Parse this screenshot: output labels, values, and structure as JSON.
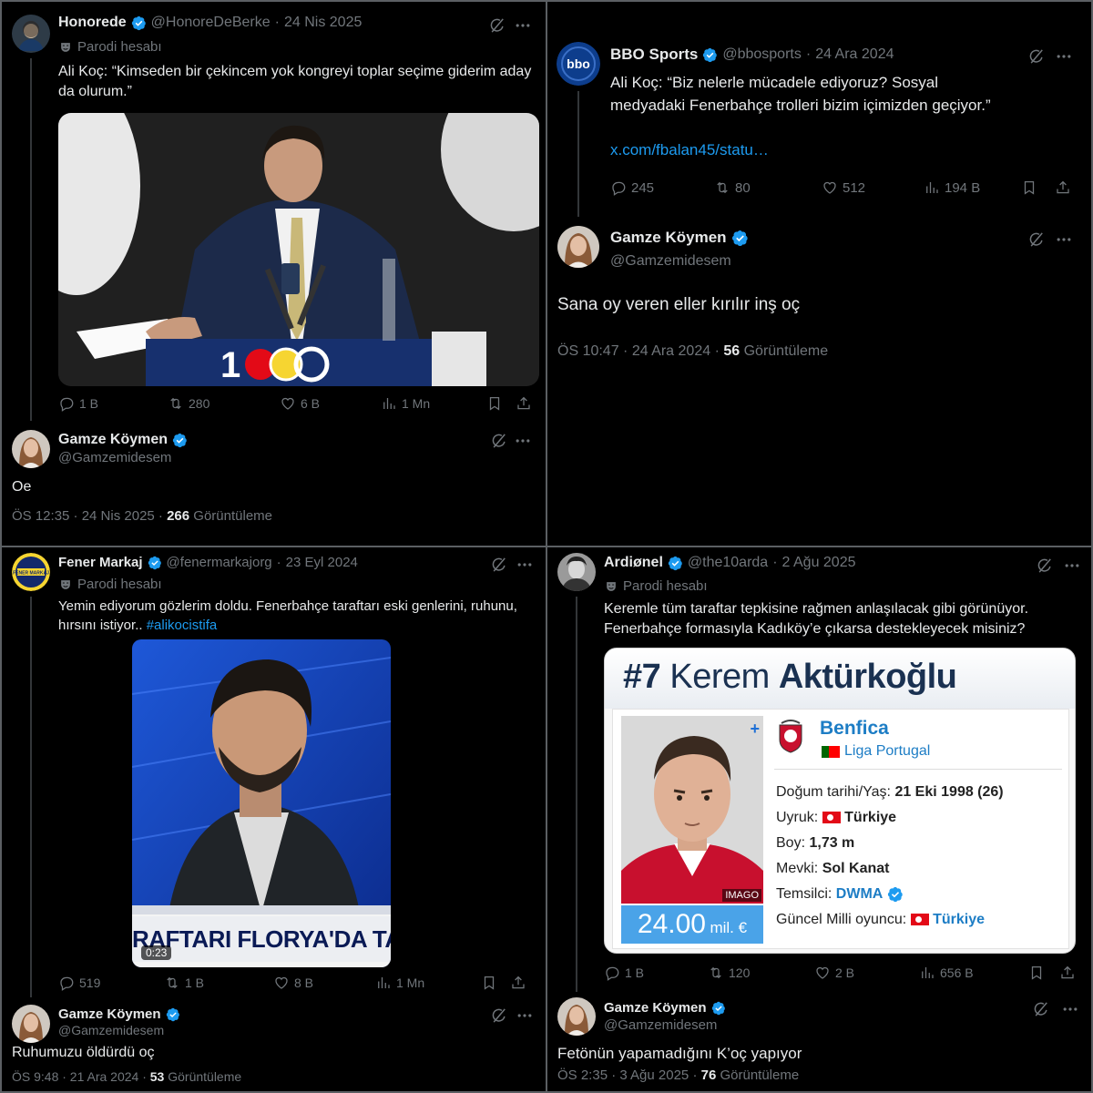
{
  "q1": {
    "author": {
      "name": "Honorede",
      "handle": "@HonoreDeBerke",
      "date": "24 Nis 2025",
      "label": "Parodi hesabı"
    },
    "text": "Ali Koç: “Kimseden bir çekincem yok kongreyi toplar seçime giderim aday da olurum.”",
    "stats": {
      "replies": "1 B",
      "reposts": "280",
      "likes": "6 B",
      "views": "1 Mn"
    },
    "reply": {
      "name": "Gamze Köymen",
      "handle": "@Gamzemidesem",
      "text": "Oe",
      "time": "ÖS 12:35 · 24 Nis 2025 · ",
      "views": "266",
      "views_label": "Görüntüleme"
    }
  },
  "q2": {
    "author": {
      "name": "BBO Sports",
      "handle": "@bbosports",
      "date": "24 Ara 2024",
      "avatar_text": "bbo"
    },
    "text": "Ali Koç: “Biz nelerle mücadele ediyoruz? Sosyal medyadaki Fenerbahçe trolleri bizim içimizden geçiyor.”",
    "link": "x.com/fbalan45/statu…",
    "stats": {
      "replies": "245",
      "reposts": "80",
      "likes": "512",
      "views": "194 B"
    },
    "reply": {
      "name": "Gamze Köymen",
      "handle": "@Gamzemidesem",
      "text": "Sana oy veren eller kırılır inş oç",
      "time": "ÖS 10:47 · 24 Ara 2024 · ",
      "views": "56",
      "views_label": "Görüntüleme"
    }
  },
  "q3": {
    "author": {
      "name": "Fener Markaj",
      "handle": "@fenermarkajorg",
      "date": "23 Eyl 2024",
      "label": "Parodi hesabı",
      "avatar_text": "FENER MARKAJ"
    },
    "text": "Yemin ediyorum gözlerim doldu. Fenerbahçe taraftarı eski genlerini, ruhunu, hırsını istiyor.. ",
    "hashtag": "#alikocistifa",
    "video": {
      "banner": "RAFTARI FLORYA'DA TAKI",
      "duration": "0:23"
    },
    "stats": {
      "replies": "519",
      "reposts": "1 B",
      "likes": "8 B",
      "views": "1 Mn"
    },
    "reply": {
      "name": "Gamze Köymen",
      "handle": "@Gamzemidesem",
      "text": "Ruhumuzu öldürdü oç",
      "time": "ÖS 9:48 · 21 Ara 2024 · ",
      "views": "53",
      "views_label": "Görüntüleme"
    }
  },
  "q4": {
    "author": {
      "name": "Ardiønel",
      "handle": "@the10arda",
      "date": "2 Ağu 2025",
      "label": "Parodi hesabı"
    },
    "text": "Keremle tüm taraftar tepkisine rağmen  anlaşılacak gibi görünüyor. Fenerbahçe formasıyla Kadıköy’e çıkarsa destekleyecek misiniz?",
    "card": {
      "number": "#7",
      "first_name": "Kerem",
      "last_name": "Aktürkoğlu",
      "club": "Benfica",
      "league": "Liga Portugal",
      "photo_credit": "IMAGO",
      "value": "24.00",
      "value_unit": "mil. €",
      "rows": [
        {
          "label": "Doğum tarihi/Yaş:",
          "value": "21 Eki 1998 (26)"
        },
        {
          "label": "Uyruk:",
          "value": "Türkiye"
        },
        {
          "label": "Boy:",
          "value": "1,73 m"
        },
        {
          "label": "Mevki:",
          "value": "Sol Kanat"
        },
        {
          "label": "Temsilci:",
          "value": "DWMA"
        },
        {
          "label": "Güncel Milli oyuncu:",
          "value": "Türkiye"
        }
      ]
    },
    "stats": {
      "replies": "1 B",
      "reposts": "120",
      "likes": "2 B",
      "views": "656 B"
    },
    "reply": {
      "name": "Gamze Köymen",
      "handle": "@Gamzemidesem",
      "text": "Fetönün yapamadığını K’oç yapıyor",
      "time": "ÖS 2:35 · 3 Ağu 2025 · ",
      "views": "76",
      "views_label": "Görüntüleme"
    }
  },
  "colors": {
    "bg": "#000000",
    "text": "#e7e9ea",
    "muted": "#71767b",
    "link": "#1d9bf0",
    "verified": "#1d9bf0"
  }
}
